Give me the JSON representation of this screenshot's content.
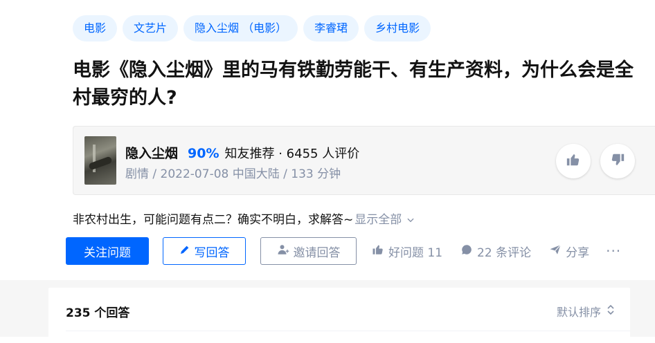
{
  "tags": [
    "电影",
    "文艺片",
    "隐入尘烟 （电影）",
    "李睿珺",
    "乡村电影"
  ],
  "question": {
    "title": "电影《隐入尘烟》里的马有铁勤劳能干、有生产资料，为什么会是全村最穷的人?",
    "description": "非农村出生，可能问题有点二？确实不明白，求解答~",
    "show_all": "显示全部"
  },
  "movie": {
    "name": "隐入尘烟",
    "score": "90%",
    "recommend": "知友推荐 · 6455 人评价",
    "meta": "剧情 / 2022-07-08 中国大陆 / 133 分钟"
  },
  "actions": {
    "follow": "关注问题",
    "write": "写回答",
    "invite": "邀请回答",
    "good_question": "好问题 11",
    "comments": "22 条评论",
    "share": "分享",
    "more": "···"
  },
  "answers": {
    "count": "235 个回答",
    "sort": "默认排序"
  },
  "colors": {
    "accent": "#0066ff",
    "tag_bg": "#ebf5ff",
    "muted": "#8590a6"
  }
}
